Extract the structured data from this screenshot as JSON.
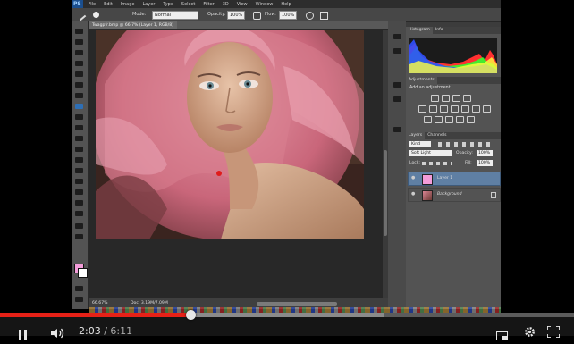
{
  "photoshop": {
    "logo": "PS",
    "menu": [
      "File",
      "Edit",
      "Image",
      "Layer",
      "Type",
      "Select",
      "Filter",
      "3D",
      "View",
      "Window",
      "Help"
    ],
    "options": {
      "mode_label": "Mode:",
      "mode_value": "Normal",
      "opacity_label": "Opacity:",
      "opacity_value": "100%",
      "flow_label": "Flow:",
      "flow_value": "100%"
    },
    "document_tab": "Twagpfr.bmp @ 66.7% (Layer 1, RGB/8)",
    "status": {
      "zoom": "66.67%",
      "doc": "Doc: 3.19M/7.09M"
    },
    "histogram_panel": {
      "tabs": [
        "Histogram",
        "Info"
      ]
    },
    "adjustments_panel": {
      "tab": "Adjustments",
      "title": "Add an adjustment"
    },
    "layers_panel": {
      "tabs": [
        "Layers",
        "Channels"
      ],
      "kind_filter": "Kind",
      "blend_mode": "Soft Light",
      "opacity_label": "Opacity:",
      "opacity_value": "100%",
      "lock_label": "Lock:",
      "fill_label": "Fill:",
      "fill_value": "100%",
      "layers": [
        {
          "name": "Layer 1",
          "selected": true
        },
        {
          "name": "Background",
          "selected": false
        }
      ]
    },
    "foreground_color": "#f39cd9",
    "background_color": "#ffffff"
  },
  "video_player": {
    "current_time": "2:03",
    "separator": "/",
    "duration": "6:11",
    "progress_played_fraction": 0.333,
    "progress_loaded_fraction": 0.67,
    "icons": [
      "pause-icon",
      "volume-icon",
      "settings-icon",
      "miniplayer-icon",
      "fullscreen-icon"
    ],
    "accent_color": "#e62117"
  }
}
